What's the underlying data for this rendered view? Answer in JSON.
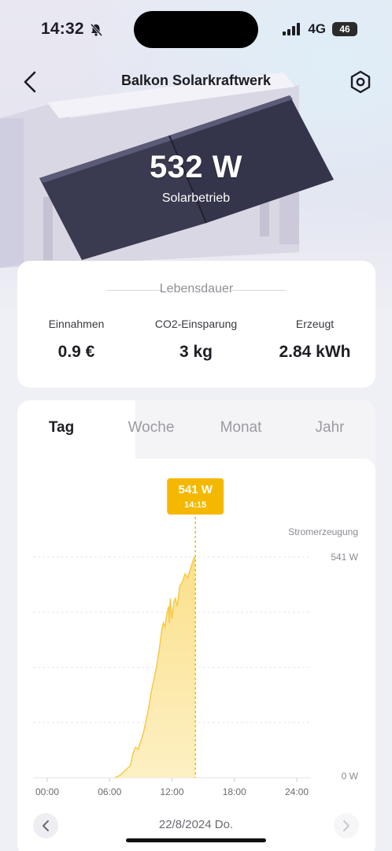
{
  "status_bar": {
    "time": "14:32",
    "network": "4G",
    "battery": "46"
  },
  "header": {
    "title": "Balkon Solarkraftwerk"
  },
  "hero": {
    "power": "532 W",
    "mode": "Solarbetrieb"
  },
  "lifetime": {
    "title": "Lebensdauer",
    "stats": [
      {
        "label": "Einnahmen",
        "value": "0.9 €"
      },
      {
        "label": "CO2-Einsparung",
        "value": "3 kg"
      },
      {
        "label": "Erzeugt",
        "value": "2.84 kWh"
      }
    ]
  },
  "tabs": [
    {
      "label": "Tag",
      "active": true
    },
    {
      "label": "Woche",
      "active": false
    },
    {
      "label": "Monat",
      "active": false
    },
    {
      "label": "Jahr",
      "active": false
    }
  ],
  "chart_data": {
    "type": "area",
    "series": [
      {
        "color": "#f7c948",
        "x": [
          "06:30",
          "07:00",
          "07:30",
          "08:00",
          "08:15",
          "08:30",
          "08:45",
          "09:00",
          "09:15",
          "09:30",
          "09:45",
          "10:00",
          "10:15",
          "10:30",
          "10:45",
          "11:00",
          "11:10",
          "11:20",
          "11:30",
          "11:40",
          "11:45",
          "11:50",
          "12:00",
          "12:10",
          "12:20",
          "12:30",
          "12:45",
          "13:00",
          "13:15",
          "13:30",
          "13:45",
          "14:00",
          "14:10",
          "14:15"
        ],
        "values": [
          0,
          6,
          18,
          30,
          60,
          75,
          70,
          90,
          110,
          140,
          170,
          210,
          240,
          270,
          310,
          360,
          380,
          370,
          400,
          420,
          380,
          440,
          390,
          430,
          440,
          420,
          470,
          480,
          500,
          490,
          510,
          530,
          541,
          541
        ]
      }
    ],
    "ylabel": "Stromerzeugung",
    "y_tick_labels": [
      "541 W",
      "0 W"
    ],
    "ylim": [
      0,
      541
    ],
    "x_ticks": [
      "00:00",
      "06:00",
      "12:00",
      "18:00",
      "24:00"
    ],
    "xlim_hours": [
      0,
      24
    ],
    "grid": true,
    "tooltip": {
      "value": "541 W",
      "time": "14:15",
      "x_hour": 14.25,
      "color": "#f5b800"
    }
  },
  "date_nav": {
    "date": "22/8/2024 Do."
  }
}
